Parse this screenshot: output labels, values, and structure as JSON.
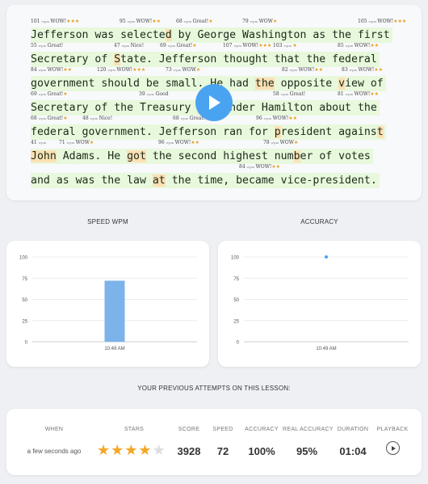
{
  "replay": {
    "lines": [
      {
        "marks": [
          {
            "wpm": "101",
            "label": "WOW!",
            "stars": "★★★"
          },
          {
            "wpm": "95",
            "label": "WOW!",
            "stars": "★★"
          },
          {
            "wpm": "68",
            "label": "Great!",
            "stars": "★"
          },
          {
            "wpm": "79",
            "label": "WOW",
            "stars": "★"
          },
          {
            "wpm": "105",
            "label": "WOW!",
            "stars": "★★★"
          }
        ],
        "segments": [
          {
            "t": "Jefferson was selecte"
          },
          {
            "t": "d",
            "hl": true
          },
          {
            "t": " by George Washington as the first"
          }
        ]
      },
      {
        "marks": [
          {
            "wpm": "55",
            "label": "Great!",
            "stars": ""
          },
          {
            "wpm": "47",
            "label": "Nice!",
            "stars": ""
          },
          {
            "wpm": "69",
            "label": "Great!",
            "stars": "★"
          },
          {
            "wpm": "107",
            "label": "WOW!",
            "stars": "★★★"
          },
          {
            "wpm": "103",
            "label": "",
            "stars": "★"
          },
          {
            "wpm": "85",
            "label": "WOW!",
            "stars": "★★"
          }
        ],
        "segments": [
          {
            "t": "Secretary of "
          },
          {
            "t": "S",
            "hl": true
          },
          {
            "t": "tate. Jefferson thought that the federal"
          }
        ]
      },
      {
        "marks": [
          {
            "wpm": "84",
            "label": "WOW!",
            "stars": "★★"
          },
          {
            "wpm": "120",
            "label": "WOW!",
            "stars": "★★★"
          },
          {
            "wpm": "73",
            "label": "WOW",
            "stars": "★"
          },
          {
            "wpm": "82",
            "label": "WOW!",
            "stars": "★★"
          },
          {
            "wpm": "83",
            "label": "WOW!",
            "stars": "★★"
          }
        ],
        "segments": [
          {
            "t": "government should be small. He had "
          },
          {
            "t": "the",
            "hl": true
          },
          {
            "t": " opposite "
          },
          {
            "t": "v",
            "hl": true
          },
          {
            "t": "iew of"
          }
        ]
      },
      {
        "marks": [
          {
            "wpm": "69",
            "label": "Great!",
            "stars": "★"
          },
          {
            "wpm": "39",
            "label": "Good",
            "stars": ""
          },
          {
            "wpm": "58",
            "label": "Great!",
            "stars": ""
          },
          {
            "wpm": "81",
            "label": "WOW!",
            "stars": "★★"
          }
        ],
        "segments": [
          {
            "t": "Secretary of the Treasury "
          },
          {
            "t": "Al",
            "hl": true
          },
          {
            "t": "exander Hamilton about the"
          }
        ]
      },
      {
        "marks": [
          {
            "wpm": "68",
            "label": "Great!",
            "stars": "★"
          },
          {
            "wpm": "48",
            "label": "Nice!",
            "stars": ""
          },
          {
            "wpm": "68",
            "label": "Great!",
            "stars": "★"
          },
          {
            "wpm": "96",
            "label": "WOW!",
            "stars": "★★"
          }
        ],
        "segments": [
          {
            "t": "federal government. Jefferson ran for "
          },
          {
            "t": "p",
            "hl": true
          },
          {
            "t": "resident agains"
          },
          {
            "t": "t",
            "hl": true
          }
        ]
      },
      {
        "marks": [
          {
            "wpm": "41",
            "label": "",
            "stars": ""
          },
          {
            "wpm": "71",
            "label": "WOW",
            "stars": "★"
          },
          {
            "wpm": "96",
            "label": "WOW!",
            "stars": "★★"
          },
          {
            "wpm": "78",
            "label": "WOW",
            "stars": "★"
          }
        ],
        "segments": [
          {
            "t": "John",
            "hl": true
          },
          {
            "t": " Adams. He "
          },
          {
            "t": "got",
            "hl": true
          },
          {
            "t": " the second highest num"
          },
          {
            "t": "b",
            "hl": true
          },
          {
            "t": "er of votes"
          }
        ]
      },
      {
        "marks": [
          {
            "wpm": "84",
            "label": "WOW!",
            "stars": "★★"
          }
        ],
        "segments": [
          {
            "t": "and as was the law "
          },
          {
            "t": "at",
            "hl": true
          },
          {
            "t": " the time, became vice-president."
          }
        ]
      }
    ],
    "wpm_unit": "wpm"
  },
  "speed_section": {
    "title": "SPEED WPM"
  },
  "accuracy_section": {
    "title": "ACCURACY"
  },
  "chart_data": [
    {
      "type": "bar",
      "title": "SPEED WPM",
      "categories": [
        "10:49 AM"
      ],
      "values": [
        72
      ],
      "ylim": [
        0,
        100
      ],
      "yticks": [
        0,
        25,
        50,
        75,
        100
      ],
      "grid": true,
      "color": "#7cb3ea"
    },
    {
      "type": "scatter",
      "title": "ACCURACY",
      "categories": [
        "10:49 AM"
      ],
      "values": [
        100
      ],
      "ylim": [
        0,
        100
      ],
      "yticks": [
        0,
        25,
        50,
        75,
        100
      ],
      "grid": true,
      "color": "#4aa3f0"
    }
  ],
  "attempts": {
    "heading": "YOUR PREVIOUS ATTEMPTS ON THIS LESSON:",
    "columns": [
      "WHEN",
      "STARS",
      "SCORE",
      "SPEED",
      "ACCURACY",
      "REAL ACCURACY",
      "DURATION",
      "PLAYBACK"
    ],
    "rows": [
      {
        "when": "a few seconds ago",
        "stars_filled": 4,
        "stars_total": 5,
        "score": "3928",
        "speed": "72",
        "accuracy": "100%",
        "real_accuracy": "95%",
        "duration": "01:04"
      }
    ]
  },
  "icons": {
    "play": "play-icon",
    "playback": "play-circle-icon",
    "star": "star-icon"
  },
  "colors": {
    "accent": "#4aa3f0",
    "bar": "#7cb3ea",
    "star": "#f5a623",
    "star_empty": "#dddddd",
    "text_bg": "#e8f8dc",
    "text_highlight": "#fbe0b4"
  }
}
